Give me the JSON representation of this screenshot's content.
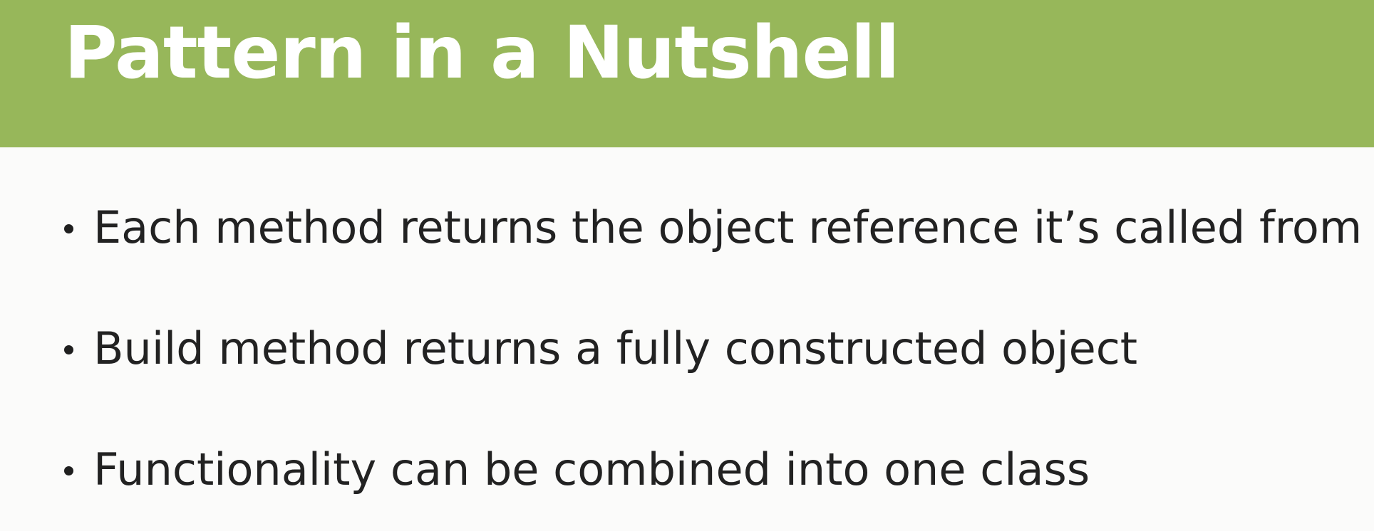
{
  "slide": {
    "title": "Pattern in a Nutshell",
    "bullets": [
      {
        "text": "Each method returns the object reference it’s called from"
      },
      {
        "text": "Build method returns a fully constructed object"
      },
      {
        "text": "Functionality can be combined into one class"
      }
    ]
  },
  "colors": {
    "title_bar": "#97b75a",
    "title_text": "#ffffff",
    "body_text": "#222222",
    "background": "#fbfbfa"
  }
}
